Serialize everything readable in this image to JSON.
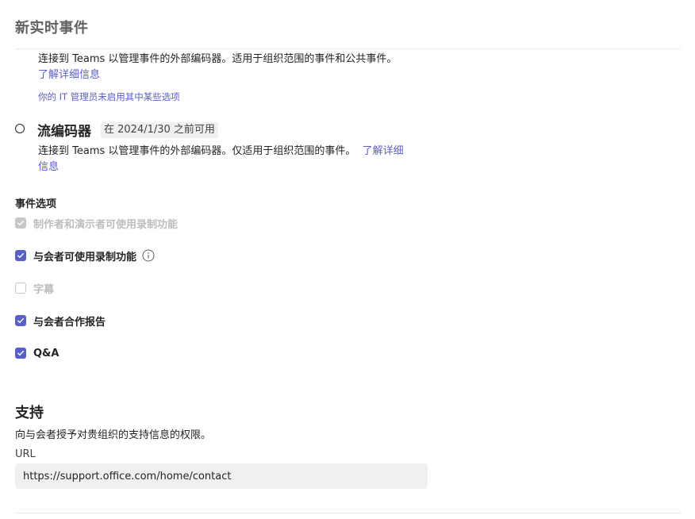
{
  "page": {
    "title": "新实时事件"
  },
  "external_encoder": {
    "description": "连接到 Teams 以管理事件的外部编码器。适用于组织范围的事件和公共事件。",
    "learn_more": "了解详细信息",
    "admin_note": "你的 IT 管理员未启用其中某些选项"
  },
  "stream_encoder": {
    "title": "流编码器",
    "badge": "在 2024/1/30 之前可用",
    "description": "连接到 Teams 以管理事件的外部编码器。仅适用于组织范围的事件。",
    "learn_more_part1": "了解详细",
    "learn_more_part2": "信息"
  },
  "event_options": {
    "label": "事件选项",
    "items": [
      {
        "label": "制作者和演示者可使用录制功能",
        "state": "checked-disabled"
      },
      {
        "label": "与会者可使用录制功能",
        "state": "checked",
        "info_icon": "info-icon"
      },
      {
        "label": "字幕",
        "state": "unchecked-disabled"
      },
      {
        "label": "与会者合作报告",
        "state": "checked"
      },
      {
        "label": "Q&A",
        "state": "checked"
      }
    ]
  },
  "support": {
    "title": "支持",
    "description": "向与会者授予对贵组织的支持信息的权限。",
    "url_label": "URL",
    "url_value": "https://support.office.com/home/contact"
  },
  "colors": {
    "accent": "#5b5fc7",
    "disabled": "#c7c7c7"
  }
}
